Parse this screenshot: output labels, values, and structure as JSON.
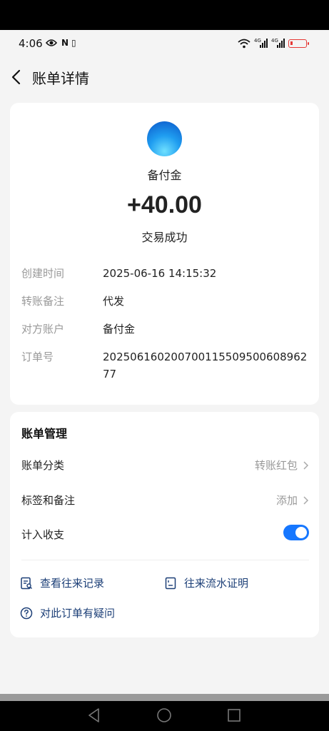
{
  "status_bar": {
    "time": "4:06",
    "nfc": "N",
    "vibrate": "▯",
    "network_1": "4G",
    "network_2": "4G"
  },
  "header": {
    "title": "账单详情"
  },
  "transaction": {
    "payee": "备付金",
    "amount": "+40.00",
    "status": "交易成功"
  },
  "details": [
    {
      "label": "创建时间",
      "value": "2025-06-16 14:15:32"
    },
    {
      "label": "转账备注",
      "value": "代发"
    },
    {
      "label": "对方账户",
      "value": "备付金"
    },
    {
      "label": "订单号",
      "value": "20250616020070011550950060896277"
    }
  ],
  "manage": {
    "title": "账单管理",
    "category_label": "账单分类",
    "category_value": "转账红包",
    "tag_label": "标签和备注",
    "tag_value": "添加",
    "income_label": "计入收支",
    "income_enabled": true
  },
  "links": {
    "records": "查看往来记录",
    "proof": "往来流水证明",
    "question": "对此订单有疑问"
  },
  "colors": {
    "accent": "#1677ff",
    "link_text": "#1c3f77",
    "battery": "#e53935"
  }
}
